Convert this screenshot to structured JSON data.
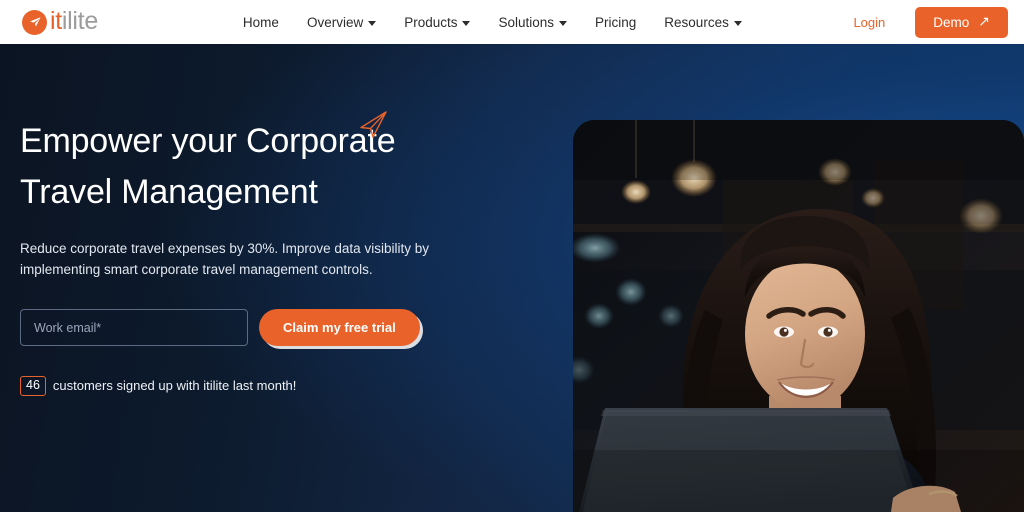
{
  "header": {
    "logo": {
      "icon": "paper-plane-icon",
      "text_orange": "it",
      "text_gray": "ilite"
    },
    "nav": [
      {
        "label": "Home",
        "has_dropdown": false
      },
      {
        "label": "Overview",
        "has_dropdown": true
      },
      {
        "label": "Products",
        "has_dropdown": true
      },
      {
        "label": "Solutions",
        "has_dropdown": true
      },
      {
        "label": "Pricing",
        "has_dropdown": false
      },
      {
        "label": "Resources",
        "has_dropdown": true
      }
    ],
    "login_label": "Login",
    "demo_label": "Demo",
    "demo_arrow": "↗"
  },
  "hero": {
    "title": "Empower your Corporate\nTravel Management",
    "subtitle": "Reduce corporate travel expenses by 30%. Improve data visibility by implementing smart corporate travel management controls.",
    "email_placeholder": "Work email*",
    "email_value": "",
    "cta_label": "Claim my free trial",
    "signup_count": "46",
    "signup_text": "customers signed up with itilite last month!",
    "decoration_icon": "paper-plane-outline-icon",
    "image_alt": "smiling-woman-with-laptop-photo"
  },
  "colors": {
    "brand_orange": "#e8622a",
    "header_background": "#ffffff",
    "hero_background_dark": "#0b1422",
    "hero_background_blue": "#0f3563",
    "logo_gray": "#9c9c9c"
  }
}
